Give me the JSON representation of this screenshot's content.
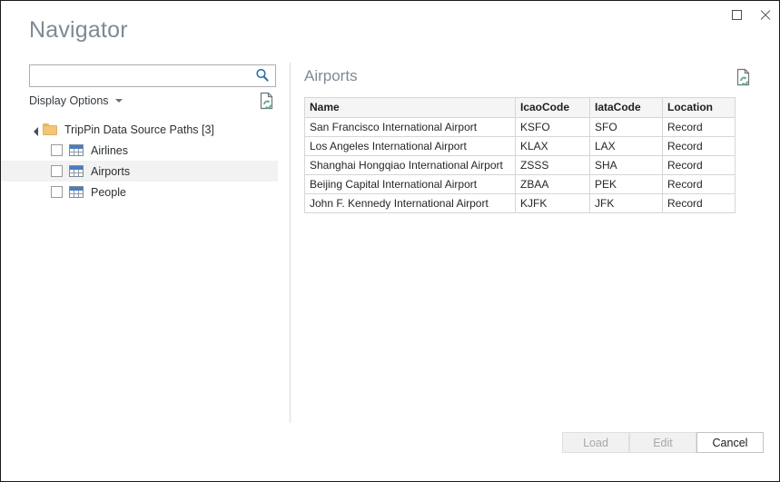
{
  "window": {
    "title": "Navigator",
    "controls": {
      "maximize": "maximize-icon",
      "close": "close-icon"
    }
  },
  "left_pane": {
    "search": {
      "value": "",
      "placeholder": "",
      "icon": "search-icon"
    },
    "display_options": {
      "label": "Display Options",
      "caret": "chevron-down-icon"
    },
    "refresh_icon": "refresh-document-icon",
    "tree": {
      "root": {
        "label": "TripPin Data Source Paths [3]",
        "expanded": true,
        "icon": "folder-icon",
        "expander": "expand-triangle-icon"
      },
      "items": [
        {
          "label": "Airlines",
          "checked": false,
          "selected": false,
          "icon": "table-icon"
        },
        {
          "label": "Airports",
          "checked": false,
          "selected": true,
          "icon": "table-icon"
        },
        {
          "label": "People",
          "checked": false,
          "selected": false,
          "icon": "table-icon"
        }
      ]
    }
  },
  "right_pane": {
    "title": "Airports",
    "refresh_icon": "refresh-document-icon",
    "table": {
      "columns": [
        "Name",
        "IcaoCode",
        "IataCode",
        "Location"
      ],
      "rows": [
        [
          "San Francisco International Airport",
          "KSFO",
          "SFO",
          "Record"
        ],
        [
          "Los Angeles International Airport",
          "KLAX",
          "LAX",
          "Record"
        ],
        [
          "Shanghai Hongqiao International Airport",
          "ZSSS",
          "SHA",
          "Record"
        ],
        [
          "Beijing Capital International Airport",
          "ZBAA",
          "PEK",
          "Record"
        ],
        [
          "John F. Kennedy International Airport",
          "KJFK",
          "JFK",
          "Record"
        ]
      ]
    }
  },
  "footer": {
    "buttons": [
      {
        "label": "Load",
        "enabled": false
      },
      {
        "label": "Edit",
        "enabled": false
      },
      {
        "label": "Cancel",
        "enabled": true
      }
    ]
  },
  "colors": {
    "title_text": "#7e8a96",
    "accent_blue": "#4a7ebb",
    "folder_orange": "#f3c677",
    "refresh_green": "#5aa88a",
    "selection_grey": "#f2f2f2",
    "table_header_bg": "#f5f5f5",
    "border": "#d6d6d6"
  }
}
